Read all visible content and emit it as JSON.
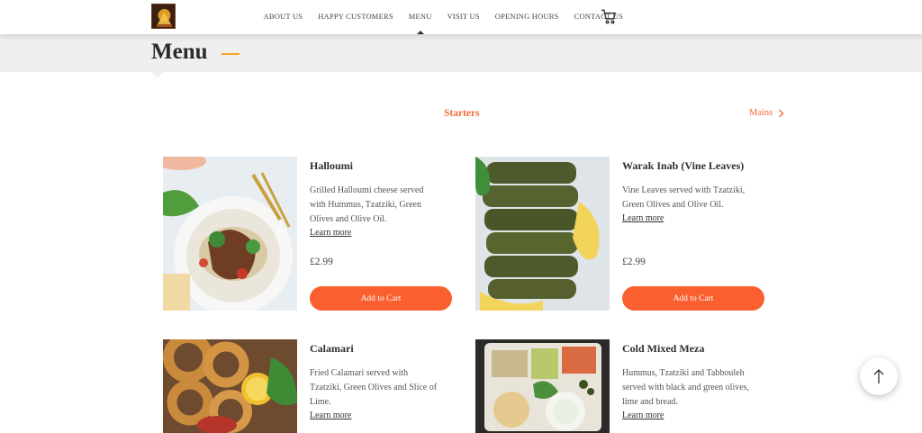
{
  "nav": {
    "items": [
      "ABOUT US",
      "HAPPY CUSTOMERS",
      "MENU",
      "VISIT US",
      "OPENING HOURS",
      "CONTACT US"
    ],
    "active": "MENU",
    "cart_icon": "cart-icon",
    "logo_icon": "restaurant-logo"
  },
  "page": {
    "title": "Menu"
  },
  "categories": {
    "current": "Starters",
    "next": "Mains",
    "next_icon": "chevron-right-icon"
  },
  "menu_items": [
    {
      "name": "Halloumi",
      "desc_lines": [
        "Grilled Halloumi cheese served",
        "with Hummus, Tzatziki, Green",
        "Olives and Olive Oil."
      ],
      "learn_more": "Learn more",
      "price": "£2.99",
      "button": "Add to Cart"
    },
    {
      "name": "Warak Inab (Vine Leaves)",
      "desc_lines": [
        "Vine Leaves served with Tzatziki,",
        "Green Olives and Olive Oil."
      ],
      "learn_more": "Learn more",
      "price": "£2.99",
      "button": "Add to Cart"
    },
    {
      "name": "Calamari",
      "desc_lines": [
        "Fried Calamari served with",
        "Tzatziki, Green Olives and Slice of",
        "Lime."
      ],
      "learn_more": "Learn more"
    },
    {
      "name": "Cold Mixed Meza",
      "desc_lines": [
        "Hummus, Tzatziki and Tabbouleh",
        "served with black and green olives,",
        "lime and bread."
      ],
      "learn_more": "Learn more"
    }
  ],
  "scroll_top_icon": "arrow-up-icon",
  "colors": {
    "accent": "#fa5f2f",
    "category": "#f26a3a",
    "title_dash": "#f5a623"
  }
}
